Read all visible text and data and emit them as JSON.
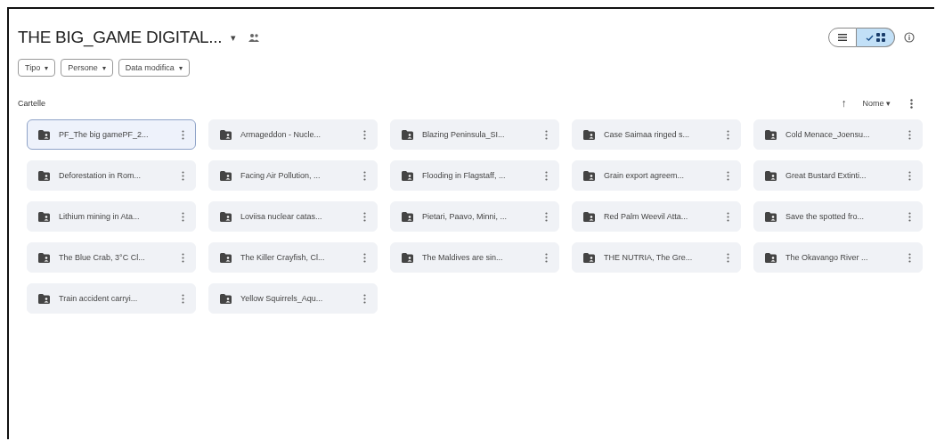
{
  "header": {
    "title": "THE BIG_GAME DIGITAL...",
    "title_caret": "▾"
  },
  "view_toggle": [
    {
      "kind": "list",
      "selected": false
    },
    {
      "kind": "grid",
      "selected": true
    }
  ],
  "filters": [
    {
      "label": "Tipo",
      "caret": "▾"
    },
    {
      "label": "Persone",
      "caret": "▾"
    },
    {
      "label": "Data modifica",
      "caret": "▾"
    }
  ],
  "section": {
    "label": "Cartelle",
    "sort_arrow": "↑",
    "sort_label": "Nome",
    "sort_caret": "▾"
  },
  "folders": [
    {
      "name": "PF_The big gamePF_2...",
      "selected": true
    },
    {
      "name": "Armageddon - Nucle...",
      "selected": false
    },
    {
      "name": "Blazing Peninsula_SI...",
      "selected": false
    },
    {
      "name": "Case Saimaa ringed s...",
      "selected": false
    },
    {
      "name": "Cold Menace_Joensu...",
      "selected": false
    },
    {
      "name": "Deforestation in Rom...",
      "selected": false
    },
    {
      "name": "Facing Air Pollution, ...",
      "selected": false
    },
    {
      "name": "Flooding in Flagstaff, ...",
      "selected": false
    },
    {
      "name": "Grain export agreem...",
      "selected": false
    },
    {
      "name": "Great Bustard Extinti...",
      "selected": false
    },
    {
      "name": "Lithium mining in Ata...",
      "selected": false
    },
    {
      "name": "Loviisa nuclear catas...",
      "selected": false
    },
    {
      "name": "Pietari, Paavo, Minni, ...",
      "selected": false
    },
    {
      "name": "Red Palm Weevil Atta...",
      "selected": false
    },
    {
      "name": "Save the spotted fro...",
      "selected": false
    },
    {
      "name": "The Blue Crab, 3°C Cl...",
      "selected": false
    },
    {
      "name": "The Killer Crayfish, Cl...",
      "selected": false
    },
    {
      "name": "The Maldives are sin...",
      "selected": false
    },
    {
      "name": "THE NUTRIA, The Gre...",
      "selected": false
    },
    {
      "name": "The Okavango River ...",
      "selected": false
    },
    {
      "name": "Train accident carryi...",
      "selected": false
    },
    {
      "name": "Yellow Squirrels_Aqu...",
      "selected": false
    }
  ]
}
